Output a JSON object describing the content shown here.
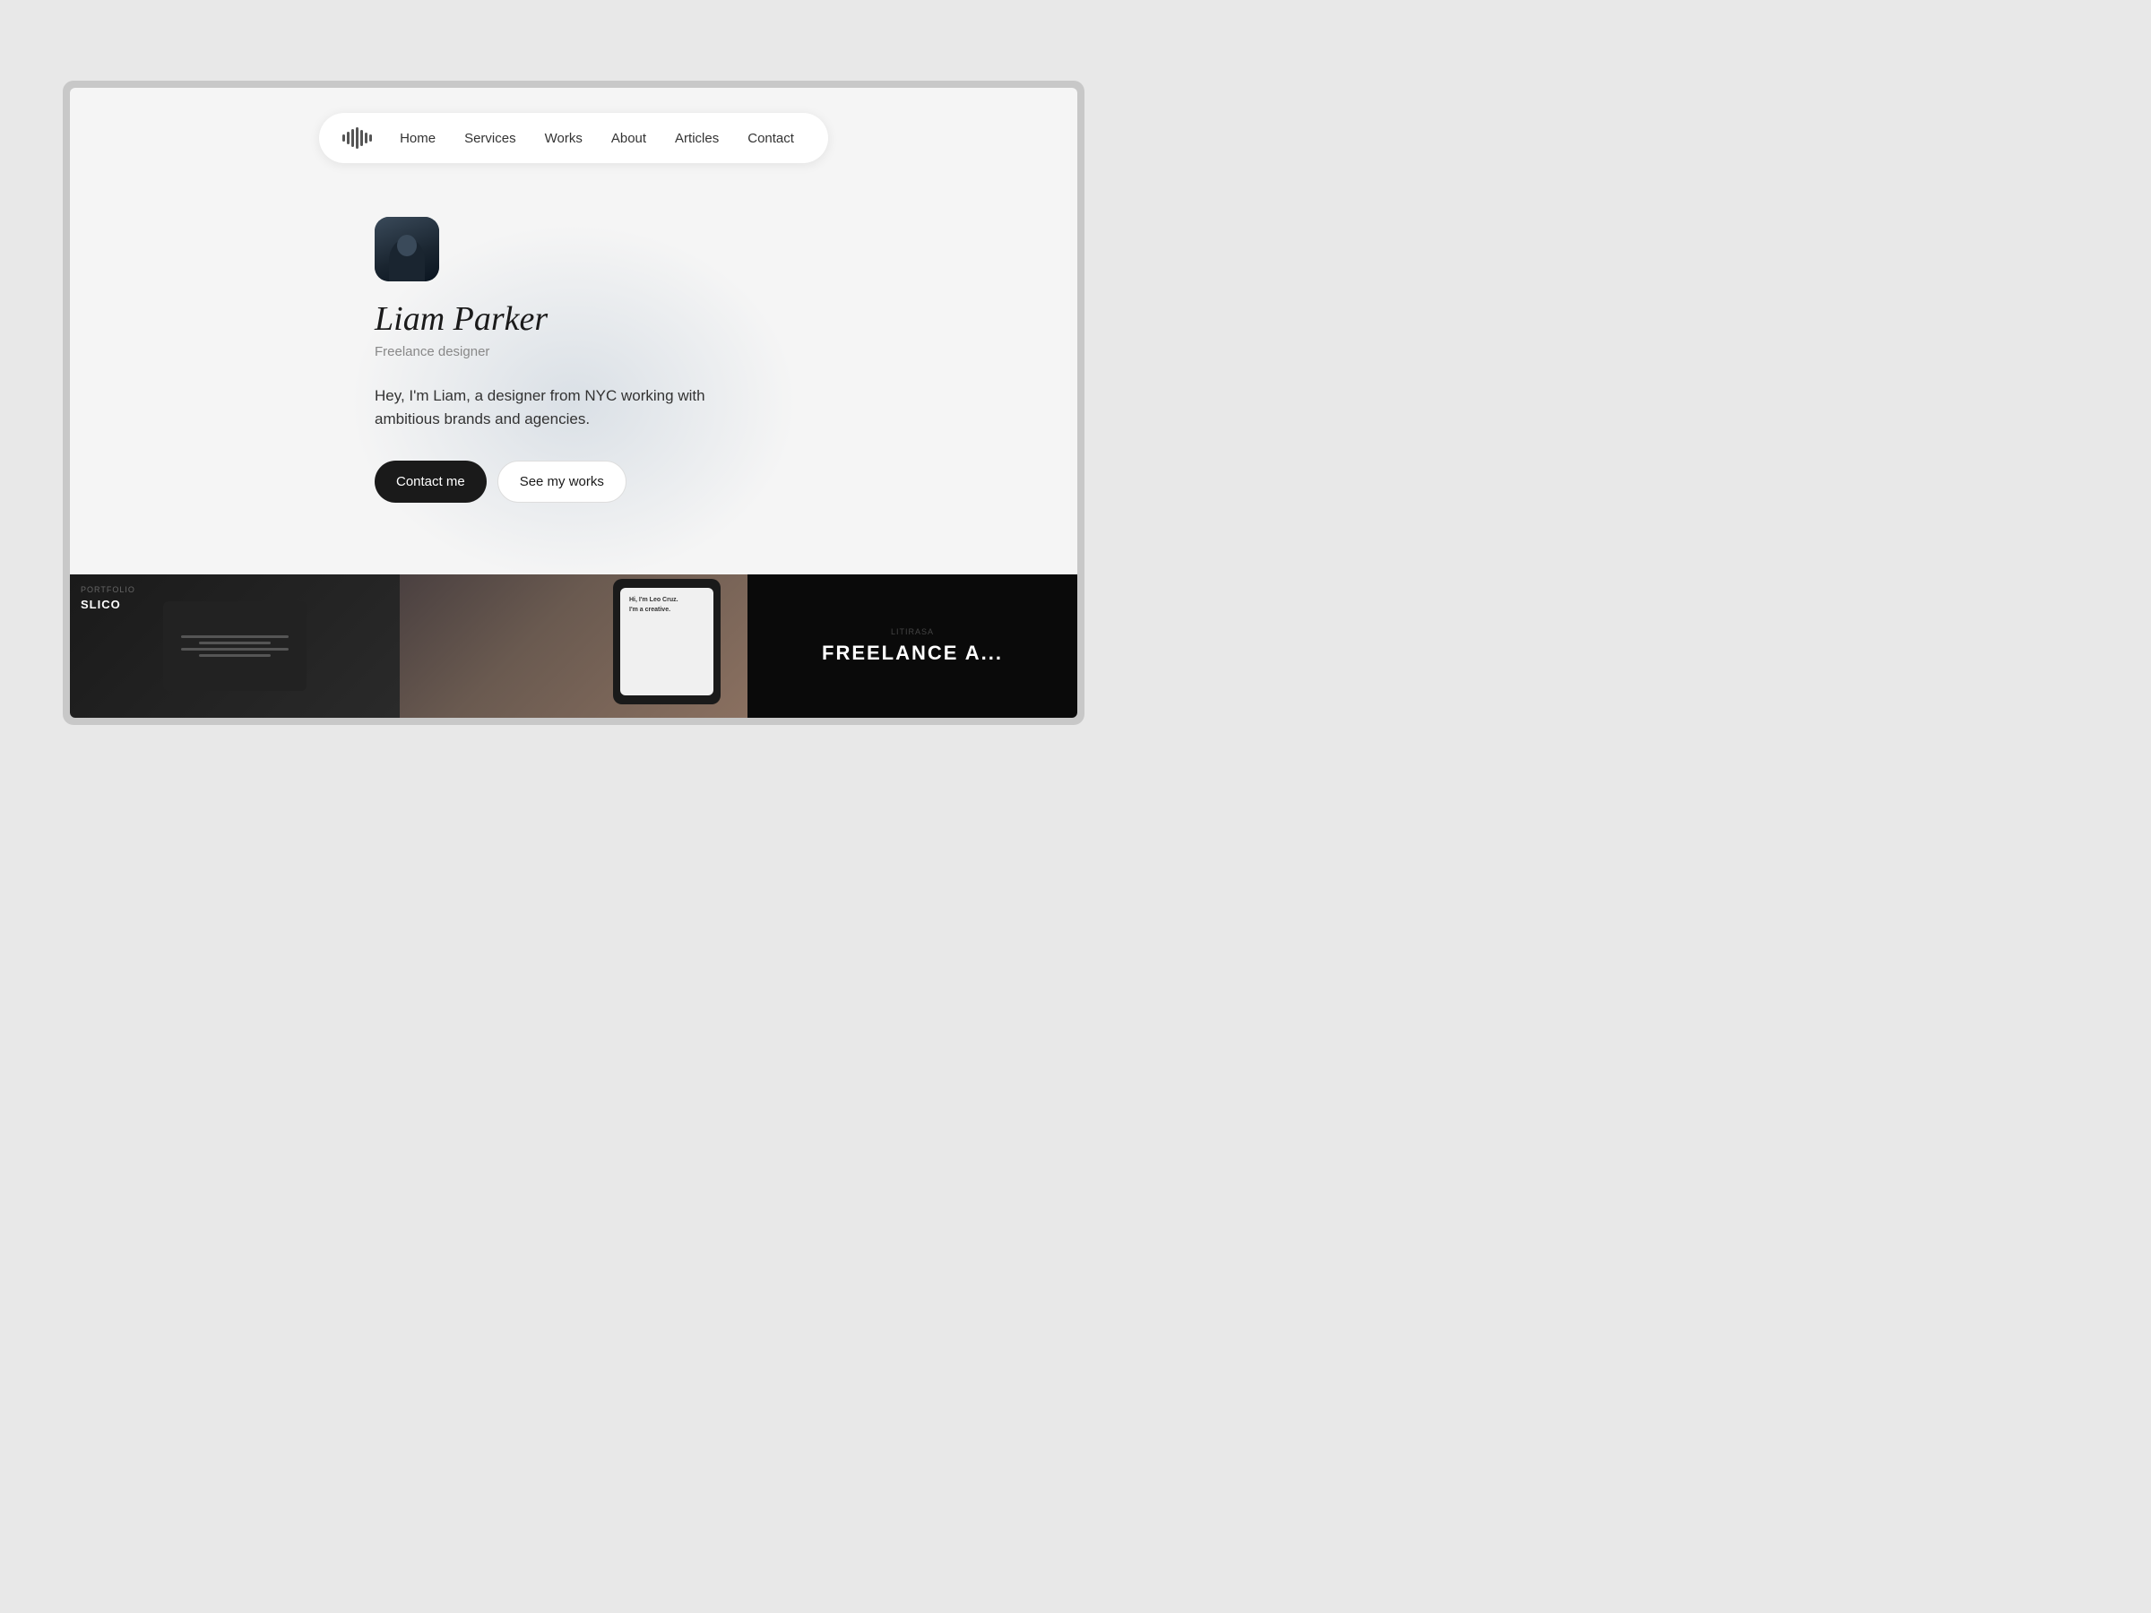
{
  "nav": {
    "logo_alt": "Logo waveform icon",
    "links": [
      {
        "label": "Home",
        "id": "home"
      },
      {
        "label": "Services",
        "id": "services"
      },
      {
        "label": "Works",
        "id": "works"
      },
      {
        "label": "About",
        "id": "about"
      },
      {
        "label": "Articles",
        "id": "articles"
      },
      {
        "label": "Contact",
        "id": "contact"
      }
    ]
  },
  "hero": {
    "name": "Liam Parker",
    "title": "Freelance designer",
    "bio": "Hey, I'm Liam, a designer from NYC working with ambitious brands and agencies.",
    "contact_btn": "Contact me",
    "works_btn": "See my works"
  },
  "portfolio": {
    "card1": {
      "label": "PORTFOLIO",
      "title": "SLICO"
    },
    "card2": {
      "greeting": "Hi, I'm Leo Cruz.",
      "sub": "I'm a creative."
    },
    "card3": {
      "label": "LITIRASA",
      "title": "FREELANCE A..."
    }
  }
}
